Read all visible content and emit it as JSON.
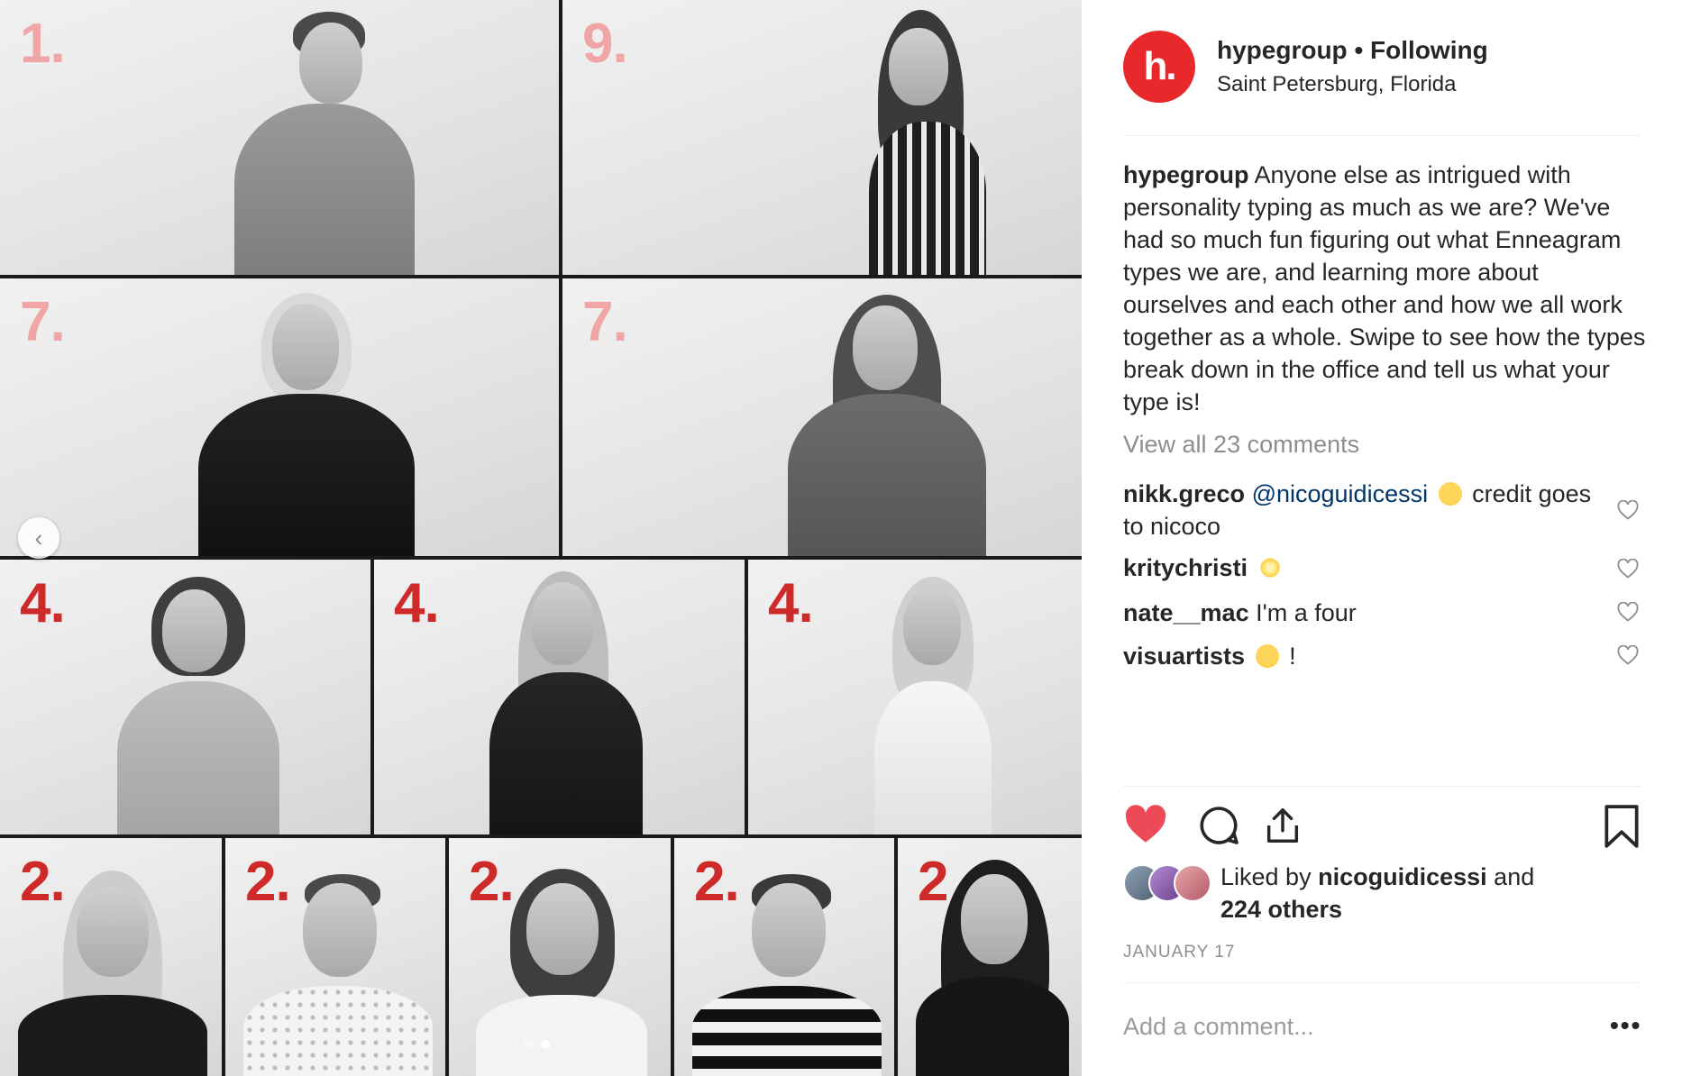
{
  "post": {
    "username": "hypegroup",
    "separator": " • ",
    "follow_status": "Following",
    "location": "Saint Petersburg, Florida",
    "avatar_text": "h."
  },
  "collage": {
    "numbers": [
      "1.",
      "9.",
      "7.",
      "7.",
      "4.",
      "4.",
      "4.",
      "2.",
      "2.",
      "2.",
      "2.",
      "2"
    ]
  },
  "caption": {
    "username": "hypegroup",
    "text": "Anyone else as intrigued with personality typing as much as we are? We've had so much fun figuring out what Enneagram types we are, and learning more about ourselves and each other and how we all work together as a whole. Swipe to see how the types break down in the office and tell us what your type is!"
  },
  "view_all_comments": "View all 23 comments",
  "comments": [
    {
      "username": "nikk.greco",
      "mention": "@nicoguidicessi",
      "emoji": "rolling-eyes-emoji",
      "text": "credit goes to nicoco"
    },
    {
      "username": "kritychristi",
      "emoji": "sparkle-star-emoji",
      "text": ""
    },
    {
      "username": "nate__mac",
      "text": "I'm a four"
    },
    {
      "username": "visuartists",
      "emoji": "grinning-face-emoji",
      "text": "!"
    }
  ],
  "likes": {
    "prefix": "Liked by",
    "user": "nicoguidicessi",
    "suffix": "and",
    "others": "224 others"
  },
  "date": "JANUARY 17",
  "add_comment_placeholder": "Add a comment...",
  "more_label": "•••",
  "colors": {
    "brand_red": "#e8282b",
    "heart_red": "#ed4956",
    "mention_blue": "#003569",
    "muted": "#8e8e8e"
  },
  "carousel": {
    "total": 2,
    "active": 2
  }
}
